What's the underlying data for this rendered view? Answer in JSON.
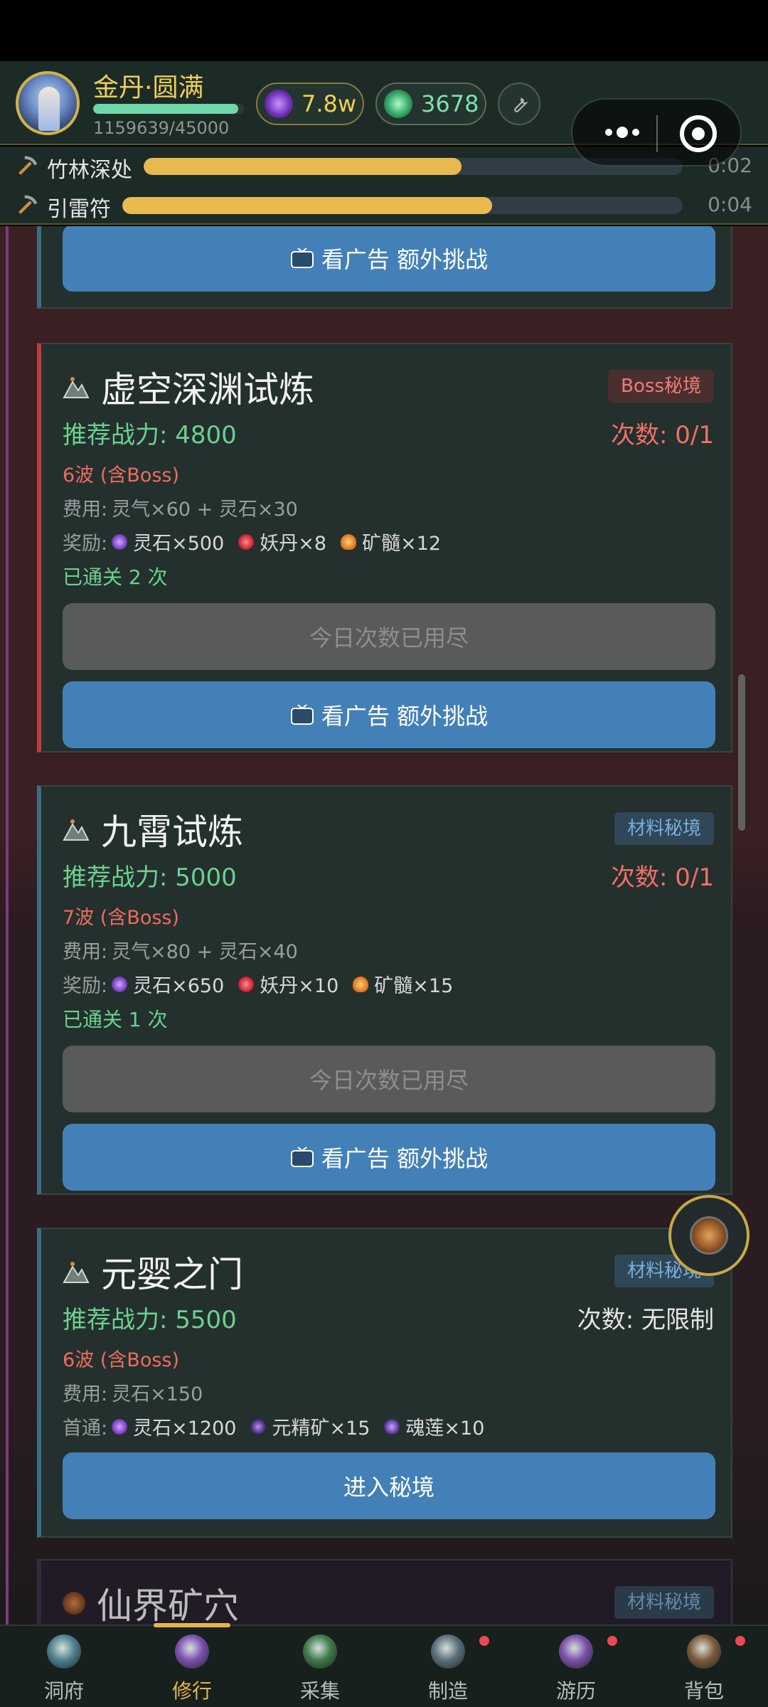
{
  "header": {
    "realm": "金丹·圆满",
    "exp_text": "1159639/45000",
    "exp_progress": 0.96,
    "spirit_stones": "7.8w",
    "jade": "3678"
  },
  "tasks": [
    {
      "name": "竹林深处",
      "progress": 0.59,
      "time": "0:02"
    },
    {
      "name": "引雷符",
      "progress": 0.66,
      "time": "0:04"
    }
  ],
  "cards": {
    "top": {
      "ad_button": "看广告 额外挑战"
    },
    "void": {
      "title": "虚空深渊试炼",
      "tag": "Boss秘境",
      "power": "推荐战力: 4800",
      "tries": "次数: 0/1",
      "waves": "6波 (含Boss)",
      "cost_label": "费用:",
      "cost": "灵气×60 + 灵石×30",
      "reward_label": "奖励:",
      "rewards": [
        "灵石×500",
        "妖丹×8",
        "矿髓×12"
      ],
      "cleared": "已通关 2 次",
      "used_button": "今日次数已用尽",
      "ad_button": "看广告 额外挑战"
    },
    "nine": {
      "title": "九霄试炼",
      "tag": "材料秘境",
      "power": "推荐战力: 5000",
      "tries": "次数: 0/1",
      "waves": "7波 (含Boss)",
      "cost_label": "费用:",
      "cost": "灵气×80 + 灵石×40",
      "reward_label": "奖励:",
      "rewards": [
        "灵石×650",
        "妖丹×10",
        "矿髓×15"
      ],
      "cleared": "已通关 1 次",
      "used_button": "今日次数已用尽",
      "ad_button": "看广告 额外挑战"
    },
    "yuanying": {
      "title": "元婴之门",
      "tag": "材料秘境",
      "power": "推荐战力: 5500",
      "tries": "次数: 无限制",
      "waves": "6波 (含Boss)",
      "cost_label": "费用:",
      "cost": "灵石×150",
      "reward_label": "首通:",
      "rewards": [
        "灵石×1200",
        "元精矿×15",
        "魂莲×10"
      ],
      "enter_button": "进入秘境"
    },
    "mine": {
      "title": "仙界矿穴",
      "tag": "材料秘境"
    }
  },
  "tabs": [
    {
      "label": "洞府",
      "icon": "cave-icon",
      "color": "#4f7f8f"
    },
    {
      "label": "修行",
      "icon": "cultivate-icon",
      "color": "#7a4fb0"
    },
    {
      "label": "采集",
      "icon": "gather-icon",
      "color": "#3f7a4a"
    },
    {
      "label": "制造",
      "icon": "craft-icon",
      "color": "#5a6f7c"
    },
    {
      "label": "游历",
      "icon": "travel-icon",
      "color": "#7a4fa8"
    },
    {
      "label": "背包",
      "icon": "bag-icon",
      "color": "#7c5a3a"
    }
  ],
  "active_tab": "修行",
  "colors": {
    "accent_gold": "#e6b64a",
    "power_green": "#6bd18f",
    "tries_red": "#f07068",
    "button_blue": "#4380b7"
  }
}
